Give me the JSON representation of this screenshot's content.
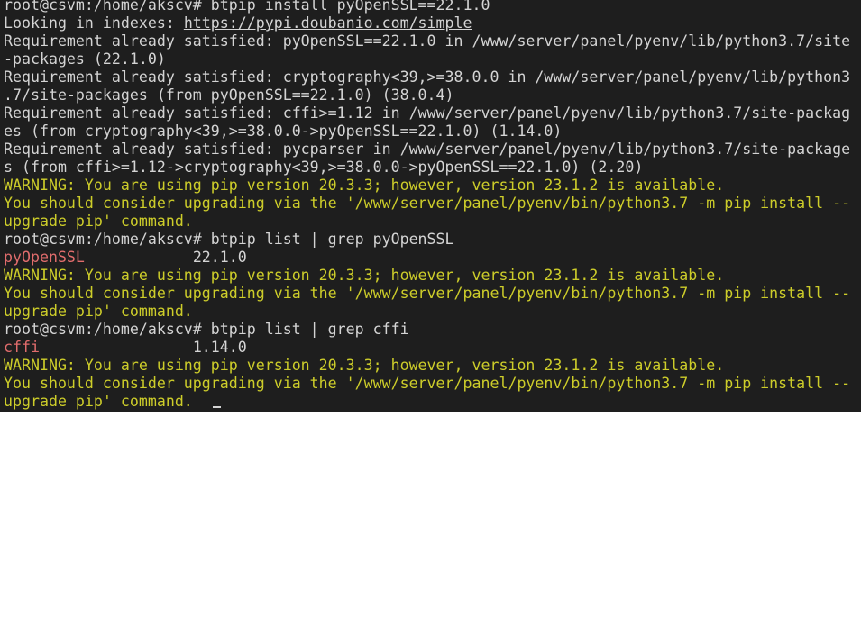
{
  "colors": {
    "background": "#1e1e1e",
    "text": "#d4d4d4",
    "warning": "#cdcd2a",
    "package_highlight": "#e06c6c",
    "page": "#ffffff"
  },
  "terminal": {
    "lines": [
      {
        "type": "prompt",
        "prompt": "root@csvm:/home/akscv# ",
        "command": "btpip install pyOpenSSL==22.1.0"
      },
      {
        "type": "index",
        "text": "Looking in indexes: ",
        "url": "https://pypi.doubanio.com/simple"
      },
      {
        "type": "text",
        "text": "Requirement already satisfied: pyOpenSSL==22.1.0 in /www/server/panel/pyenv/lib/python3.7/site"
      },
      {
        "type": "text",
        "text": "-packages (22.1.0)"
      },
      {
        "type": "text",
        "text": "Requirement already satisfied: cryptography<39,>=38.0.0 in /www/server/panel/pyenv/lib/python3"
      },
      {
        "type": "text",
        "text": ".7/site-packages (from pyOpenSSL==22.1.0) (38.0.4)"
      },
      {
        "type": "text",
        "text": "Requirement already satisfied: cffi>=1.12 in /www/server/panel/pyenv/lib/python3.7/site-packag"
      },
      {
        "type": "text",
        "text": "es (from cryptography<39,>=38.0.0->pyOpenSSL==22.1.0) (1.14.0)"
      },
      {
        "type": "text",
        "text": "Requirement already satisfied: pycparser in /www/server/panel/pyenv/lib/python3.7/site-package"
      },
      {
        "type": "text",
        "text": "s (from cffi>=1.12->cryptography<39,>=38.0.0->pyOpenSSL==22.1.0) (2.20)"
      },
      {
        "type": "warning",
        "text": "WARNING: You are using pip version 20.3.3; however, version 23.1.2 is available."
      },
      {
        "type": "warning",
        "text": "You should consider upgrading via the '/www/server/panel/pyenv/bin/python3.7 -m pip install --"
      },
      {
        "type": "warning",
        "text": "upgrade pip' command."
      },
      {
        "type": "prompt",
        "prompt": "root@csvm:/home/akscv# ",
        "command": "btpip list | grep pyOpenSSL"
      },
      {
        "type": "package",
        "name": "pyOpenSSL",
        "pad": "            ",
        "version": "22.1.0"
      },
      {
        "type": "warning",
        "text": "WARNING: You are using pip version 20.3.3; however, version 23.1.2 is available."
      },
      {
        "type": "warning",
        "text": "You should consider upgrading via the '/www/server/panel/pyenv/bin/python3.7 -m pip install --"
      },
      {
        "type": "warning",
        "text": "upgrade pip' command."
      },
      {
        "type": "prompt",
        "prompt": "root@csvm:/home/akscv# ",
        "command": "btpip list | grep cffi"
      },
      {
        "type": "package",
        "name": "cffi",
        "pad": "                 ",
        "version": "1.14.0"
      },
      {
        "type": "warning",
        "text": "WARNING: You are using pip version 20.3.3; however, version 23.1.2 is available."
      },
      {
        "type": "warning",
        "text": "You should consider upgrading via the '/www/server/panel/pyenv/bin/python3.7 -m pip install --"
      },
      {
        "type": "warning-cursor",
        "text": "upgrade pip' command."
      }
    ]
  }
}
